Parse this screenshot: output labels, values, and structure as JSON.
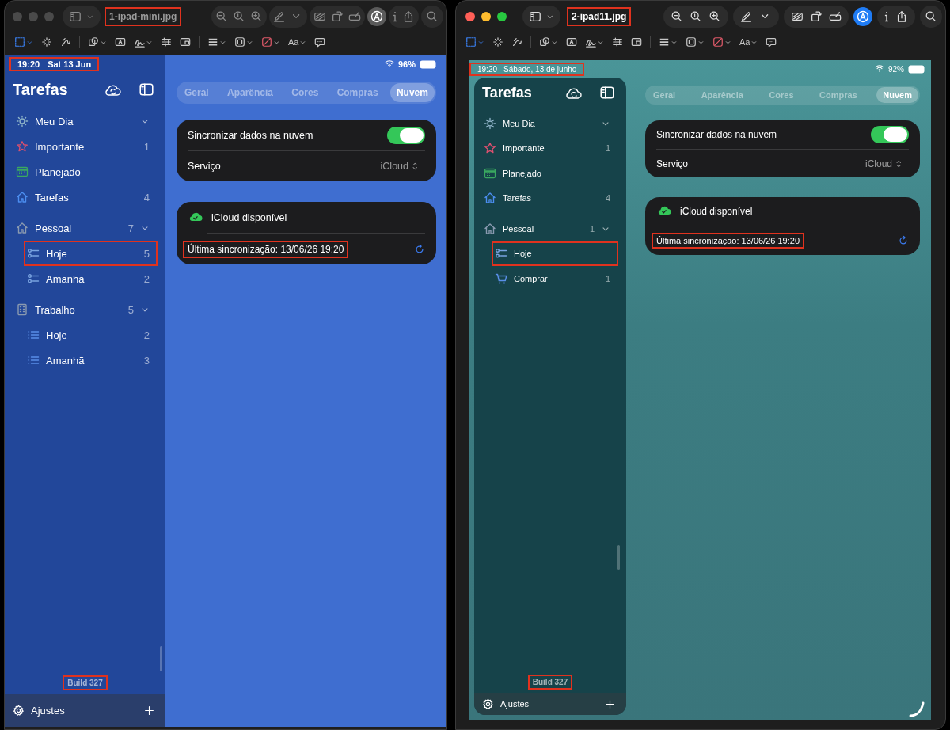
{
  "windows": [
    {
      "active": false,
      "filename": "1-ipad-mini.jpg",
      "filename_marked": true,
      "font_menu_label": "Aa",
      "screenshot": {
        "kind": "docked",
        "time": "19:20",
        "date": "Sat 13 Jun",
        "time_marked": true,
        "battery": "96%",
        "sidebar": {
          "title": "Tarefas",
          "items": [
            {
              "kind": "sun",
              "label": "Meu Dia",
              "expanded": true,
              "marked": false
            },
            {
              "kind": "star",
              "label": "Importante",
              "count": "1",
              "marked": false
            },
            {
              "kind": "calendar",
              "label": "Planejado",
              "marked": false
            },
            {
              "kind": "house",
              "label": "Tarefas",
              "count": "4",
              "marked": false
            },
            {
              "kind": "house-outline",
              "label": "Pessoal",
              "count": "7",
              "expanded": true,
              "marked": false,
              "children": [
                {
                  "kind": "checklist",
                  "label": "Hoje",
                  "count": "5",
                  "marked": true
                },
                {
                  "kind": "checklist",
                  "label": "Amanhã",
                  "count": "2",
                  "marked": false
                }
              ]
            },
            {
              "kind": "building",
              "label": "Trabalho",
              "count": "5",
              "expanded": true,
              "marked": false,
              "children": [
                {
                  "kind": "list",
                  "label": "Hoje",
                  "count": "2",
                  "marked": false
                },
                {
                  "kind": "list",
                  "label": "Amanhã",
                  "count": "3",
                  "marked": false
                }
              ]
            }
          ],
          "build": "Build 327",
          "build_marked": true,
          "settings": "Ajustes"
        },
        "tabs": [
          {
            "label": "Geral",
            "selected": false
          },
          {
            "label": "Aparência",
            "selected": false
          },
          {
            "label": "Cores",
            "selected": false
          },
          {
            "label": "Compras",
            "selected": false
          },
          {
            "label": "Nuvem",
            "selected": true
          }
        ],
        "sync_card": {
          "label": "Sincronizar dados na nuvem",
          "on": true,
          "service_label": "Serviço",
          "service_value": "iCloud"
        },
        "status_card": {
          "title": "iCloud disponível",
          "last_sync": "Última sincronização: 13/06/26 19:20",
          "last_sync_marked": true
        }
      }
    },
    {
      "active": true,
      "filename": "2-ipad11.jpg",
      "filename_marked": true,
      "font_menu_label": "Aa",
      "screenshot": {
        "kind": "floating",
        "time": "19:20",
        "date": "Sábado, 13 de junho",
        "time_marked": true,
        "battery": "92%",
        "sidebar": {
          "title": "Tarefas",
          "items": [
            {
              "kind": "sun",
              "label": "Meu Dia",
              "expanded": true,
              "marked": false
            },
            {
              "kind": "star",
              "label": "Importante",
              "count": "1",
              "marked": false
            },
            {
              "kind": "calendar",
              "label": "Planejado",
              "marked": false
            },
            {
              "kind": "house",
              "label": "Tarefas",
              "count": "4",
              "marked": false
            },
            {
              "kind": "house-outline",
              "label": "Pessoal",
              "count": "1",
              "expanded": true,
              "marked": false,
              "children": [
                {
                  "kind": "checklist",
                  "label": "Hoje",
                  "marked": true
                },
                {
                  "kind": "cart",
                  "label": "Comprar",
                  "count": "1",
                  "marked": false
                }
              ]
            }
          ],
          "build": "Build 327",
          "build_marked": true,
          "settings": "Ajustes"
        },
        "tabs": [
          {
            "label": "Geral",
            "selected": false
          },
          {
            "label": "Aparência",
            "selected": false
          },
          {
            "label": "Cores",
            "selected": false
          },
          {
            "label": "Compras",
            "selected": false
          },
          {
            "label": "Nuvem",
            "selected": true
          }
        ],
        "sync_card": {
          "label": "Sincronizar dados na nuvem",
          "on": true,
          "service_label": "Serviço",
          "service_value": "iCloud"
        },
        "status_card": {
          "title": "iCloud disponível",
          "last_sync": "Última sincronização: 13/06/26 19:20",
          "last_sync_marked": true
        }
      }
    }
  ]
}
